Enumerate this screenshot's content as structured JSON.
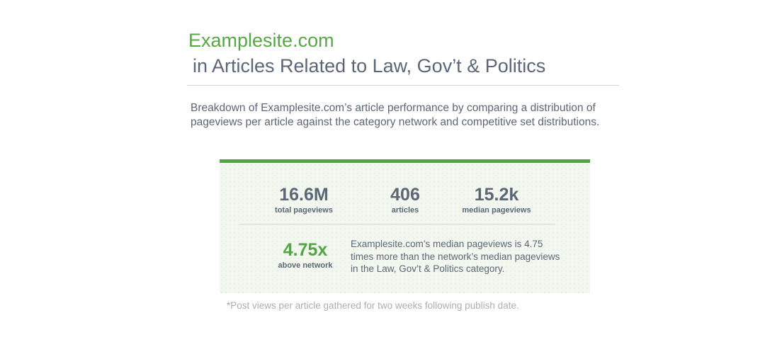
{
  "header": {
    "site_name": "Examplesite.com",
    "title": "in Articles Related to Law, Gov’t & Politics"
  },
  "description": "Breakdown of Examplesite.com’s article performance by comparing a distribution of pageviews per article against the category network and competitive set distributions.",
  "stats": {
    "total_pageviews": {
      "value": "16.6M",
      "label": "total pageviews"
    },
    "articles": {
      "value": "406",
      "label": "articles"
    },
    "median_pageviews": {
      "value": "15.2k",
      "label": "median pageviews"
    },
    "above_network": {
      "value": "4.75x",
      "label": "above network"
    },
    "network_note": "Examplesite.com’s median pageviews is 4.75 times more than the network’s median pageviews in the Law, Gov’t & Politics category."
  },
  "footnote": "*Post views per article gathered for two weeks following publish date.",
  "colors": {
    "accent": "#55a448",
    "text": "#5c6675",
    "muted": "#a8afb8",
    "card_bg": "#f2f8ef"
  }
}
